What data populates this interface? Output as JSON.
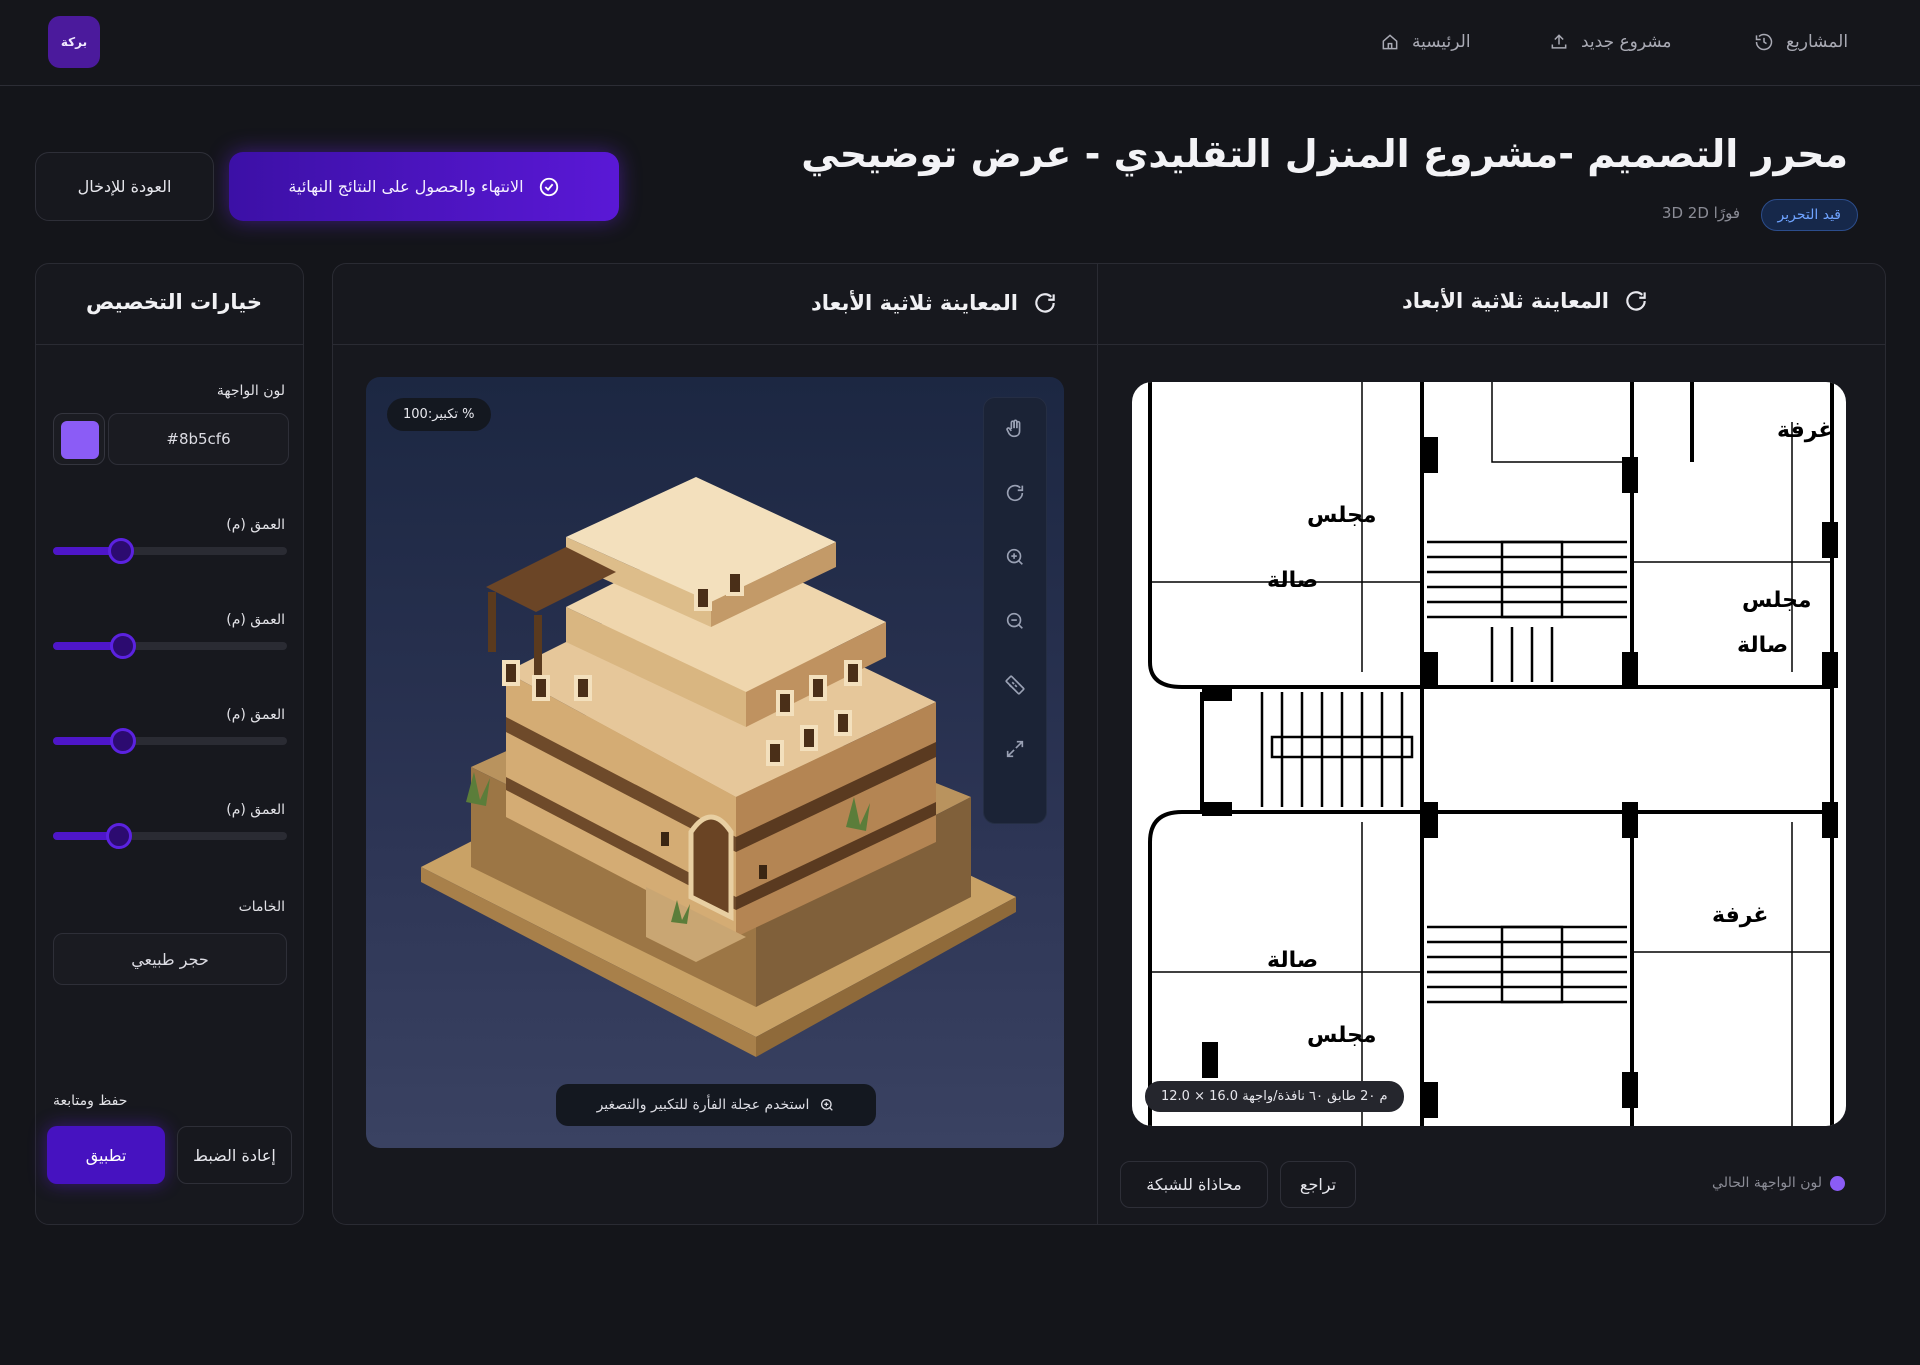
{
  "app": {
    "logo_text": "بركة"
  },
  "nav": {
    "projects": "المشاريع",
    "new_project": "مشروع جديد",
    "home": "الرئيسية"
  },
  "header": {
    "title": "محرر التصميم -مشروع المنزل التقليدي - عرض توضيحي",
    "status_badge": "قيد التحرير",
    "subtitle": "3D 2D فورًا",
    "finish_button": "الانتهاء والحصول على النتائج النهائية",
    "back_button": "العودة للإدخال"
  },
  "options_panel": {
    "title": "خيارات التخصيص",
    "facade_color_label": "لون الواجهة",
    "facade_color_value": "#8b5cf6",
    "facade_color_hex": "#8b5cf6",
    "sliders": [
      {
        "label": "العمق (م)",
        "value": 0.29
      },
      {
        "label": "العمق (م)",
        "value": 0.3
      },
      {
        "label": "العمق (م)",
        "value": 0.3
      },
      {
        "label": "العمق (م)",
        "value": 0.28
      }
    ],
    "materials_label": "الخامات",
    "material_value": "حجر طبيعي",
    "save_label": "حفظ ومتابعة",
    "apply_button": "تطبيق",
    "reset_button": "إعادة الضبط"
  },
  "preview_3d": {
    "title": "المعاينة ثلاثية الأبعاد",
    "zoom_label": "% تكبير:100",
    "hint": "استخدم عجلة الفأرة للتكبير والتصغير",
    "tools": [
      "hand-icon",
      "rotate-icon",
      "zoom-in-icon",
      "zoom-out-icon",
      "ruler-icon",
      "expand-icon"
    ]
  },
  "preview_plan": {
    "title": "المعاينة ثلاثية الأبعاد",
    "info_pill": "م 2٠ طابق ٦٠ نافذة/واجهة 16.0 × 12.0",
    "grid_button": "محاذاة للشبكة",
    "undo_button": "تراجع",
    "current_color_label": "لون الواجهة الحالي",
    "room_labels": [
      "مجلس",
      "صالة",
      "غرفة"
    ]
  }
}
